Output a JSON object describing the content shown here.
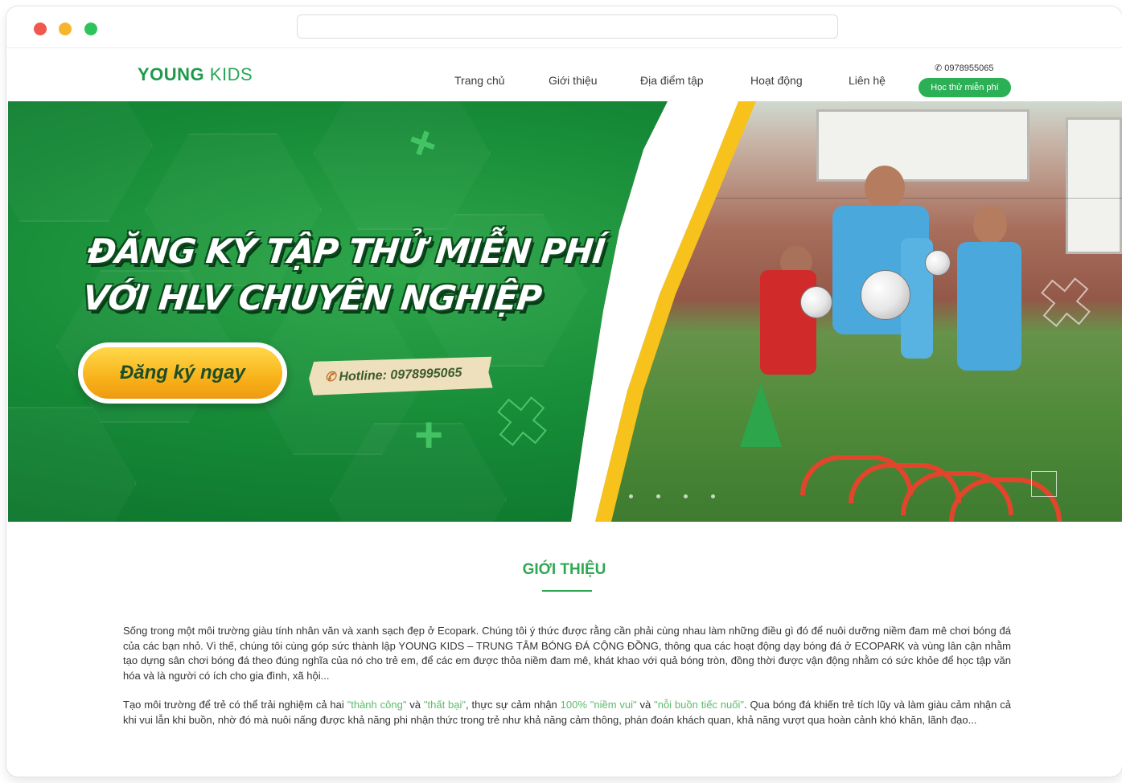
{
  "header": {
    "logo_bold": "YOUNG",
    "logo_light": " KIDS",
    "menu": [
      {
        "label": "Trang chủ"
      },
      {
        "label": "Giới thiệu"
      },
      {
        "label": "Địa điểm tập"
      },
      {
        "label": "Hoạt động"
      },
      {
        "label": "Liên hệ"
      }
    ],
    "phone": "0978955065",
    "trial_button": "Học thử miễn phí"
  },
  "hero": {
    "headline_line1": "ĐĂNG KÝ TẬP THỬ MIỄN PHÍ",
    "headline_line2": "VỚI HLV CHUYÊN NGHIỆP",
    "register_button": "Đăng ký ngay",
    "hotline": "Hotline: 0978995065",
    "slides_count": 4
  },
  "intro": {
    "title": "GIỚI THIỆU",
    "paragraph1": "Sống trong một môi trường giàu tính nhân văn và xanh sạch đẹp ở Ecopark. Chúng tôi ý thức được rằng cần phải cùng nhau làm những điều gì đó để nuôi dưỡng niềm đam mê chơi bóng đá của các bạn nhỏ. Vì thế, chúng tôi cùng góp sức thành lập YOUNG KIDS – TRUNG TÂM BÓNG ĐÁ CỘNG ĐỒNG, thông qua các hoạt động dạy bóng đá ở ECOPARK và vùng lân cận nhằm tạo dựng sân chơi bóng đá theo đúng nghĩa của nó cho trẻ em, để các em được thỏa niềm đam mê, khát khao với quả bóng tròn, đồng thời được vận động nhằm có sức khỏe để học tập văn hóa và là người có ích cho gia đình, xã hội...",
    "p2_a": "Tạo môi trường để trẻ có thể trải nghiệm cả hai ",
    "p2_hl1": "\"thành công\"",
    "p2_b": " và ",
    "p2_hl2": "\"thất bại\"",
    "p2_c": ", thực sự cảm nhận ",
    "p2_hl3": "100% \"niềm vui\"",
    "p2_d": " và ",
    "p2_hl4": "\"nỗi buồn tiếc nuối\"",
    "p2_e": ". Qua bóng đá khiến trẻ tích lũy và làm giàu cảm nhận cả khi vui lẫn khi buồn, nhờ đó mà nuôi nấng được khả năng phi nhận thức trong trẻ như khả năng cảm thông, phán đoán khách quan, khả năng vượt qua hoàn cảnh khó khăn, lãnh đạo..."
  },
  "colors": {
    "brand_green": "#2bb055",
    "accent_yellow": "#f8c21d"
  }
}
